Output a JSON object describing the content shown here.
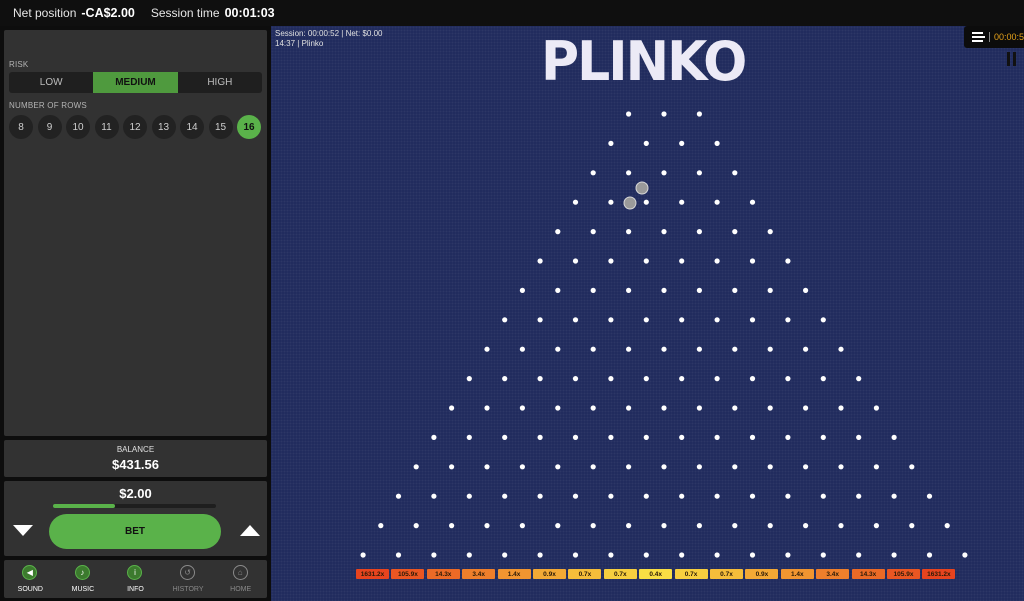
{
  "topbar": {
    "net_position_label": "Net position",
    "net_position_value": "-CA$2.00",
    "session_time_label": "Session time",
    "session_time_value": "00:01:03"
  },
  "risk": {
    "label": "RISK",
    "options": [
      "LOW",
      "MEDIUM",
      "HIGH"
    ],
    "selected": "MEDIUM"
  },
  "rows": {
    "label": "NUMBER OF ROWS",
    "options": [
      "8",
      "9",
      "10",
      "11",
      "12",
      "13",
      "14",
      "15",
      "16"
    ],
    "selected": "16"
  },
  "balance": {
    "label": "BALANCE",
    "value": "$431.56"
  },
  "bet": {
    "amount": "$2.00",
    "slider_fraction": 0.38,
    "button_label": "BET"
  },
  "nav": [
    {
      "label": "SOUND",
      "icon": "speaker-icon",
      "active": true
    },
    {
      "label": "MUSIC",
      "icon": "music-note-icon",
      "active": true
    },
    {
      "label": "INFO",
      "icon": "info-icon",
      "active": true
    },
    {
      "label": "HISTORY",
      "icon": "history-icon",
      "active": false
    },
    {
      "label": "HOME",
      "icon": "home-icon",
      "active": false
    }
  ],
  "game": {
    "session_line": "Session: 00:00:52",
    "net_line": "Net:   $0.00",
    "time_line": "14:37",
    "game_name": "Plinko",
    "logo_text": "PLINKO",
    "clock": "00:00:5",
    "multipliers": [
      "1631.2x",
      "105.9x",
      "14.3x",
      "3.4x",
      "1.4x",
      "0.9x",
      "0.7x",
      "0.7x",
      "0.4x",
      "0.7x",
      "0.7x",
      "0.9x",
      "1.4x",
      "3.4x",
      "14.3x",
      "105.9x",
      "1631.2x"
    ],
    "multiplier_colors": [
      "#e8441e",
      "#ea5622",
      "#ec6a26",
      "#ef7f2b",
      "#f19530",
      "#f3a935",
      "#f5bd3a",
      "#f7cf3f",
      "#f9de44",
      "#f7cf3f",
      "#f5bd3a",
      "#f3a935",
      "#f19530",
      "#ef7f2b",
      "#ec6a26",
      "#ea5622",
      "#e8441e"
    ]
  }
}
